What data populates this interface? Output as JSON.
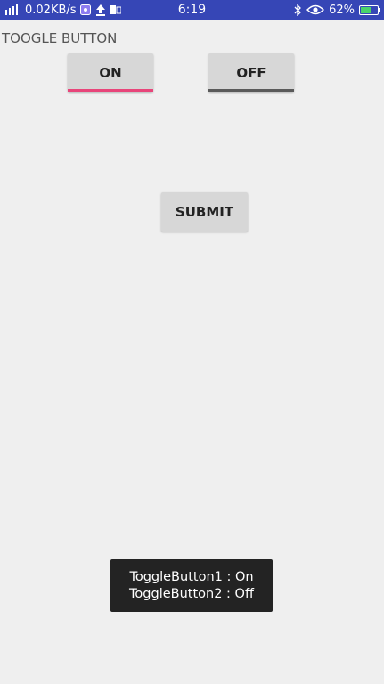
{
  "status_bar": {
    "network_speed": "0.02KB/s",
    "time": "6:19",
    "battery_percent": "62%",
    "battery_level": 0.62,
    "left_icons": [
      "signal-icon",
      "wifi-hotspot-icon",
      "upload-icon",
      "notification-icon"
    ],
    "right_icons": [
      "bluetooth-icon",
      "eye-icon",
      "battery-icon"
    ],
    "background_color": "#3646b6"
  },
  "app": {
    "title": "TOOGLE BUTTON"
  },
  "toggles": {
    "first": {
      "label": "ON",
      "state": "on",
      "indicator_color": "#e8457a"
    },
    "second": {
      "label": "OFF",
      "state": "off",
      "indicator_color": "#5a5a5a"
    }
  },
  "submit": {
    "label": "SUBMIT"
  },
  "toast": {
    "line1": "ToggleButton1 : On",
    "line2": "ToggleButton2 : Off"
  }
}
